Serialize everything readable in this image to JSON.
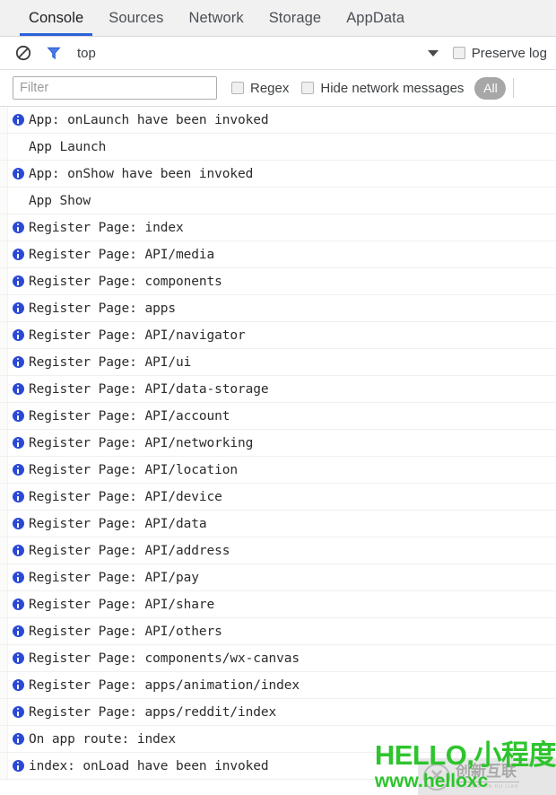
{
  "tabs": [
    {
      "label": "Console",
      "active": true
    },
    {
      "label": "Sources",
      "active": false
    },
    {
      "label": "Network",
      "active": false
    },
    {
      "label": "Storage",
      "active": false
    },
    {
      "label": "AppData",
      "active": false
    }
  ],
  "toolbar": {
    "clear_icon": "clear-console-icon",
    "filter_icon": "funnel-filter-icon",
    "context_selector": "top",
    "dropdown_icon": "chevron-down-icon",
    "preserve_log_label": "Preserve log",
    "preserve_log_checked": false
  },
  "filterbar": {
    "filter_placeholder": "Filter",
    "filter_value": "",
    "regex_label": "Regex",
    "regex_checked": false,
    "hide_network_label": "Hide network messages",
    "hide_network_checked": false,
    "level_pill": "All"
  },
  "colors": {
    "accent": "#2962d9",
    "info_icon": "#2a49d6",
    "tabbar_bg": "#f1f1f1",
    "watermark_green": "#2ec42e",
    "pill_gray": "#a7a7a7"
  },
  "logs": [
    {
      "level": "info",
      "text": "App: onLaunch have been invoked"
    },
    {
      "level": "plain",
      "text": "App Launch"
    },
    {
      "level": "info",
      "text": "App: onShow have been invoked"
    },
    {
      "level": "plain",
      "text": "App Show"
    },
    {
      "level": "info",
      "text": "Register Page: index"
    },
    {
      "level": "info",
      "text": "Register Page: API/media"
    },
    {
      "level": "info",
      "text": "Register Page: components"
    },
    {
      "level": "info",
      "text": "Register Page: apps"
    },
    {
      "level": "info",
      "text": "Register Page: API/navigator"
    },
    {
      "level": "info",
      "text": "Register Page: API/ui"
    },
    {
      "level": "info",
      "text": "Register Page: API/data-storage"
    },
    {
      "level": "info",
      "text": "Register Page: API/account"
    },
    {
      "level": "info",
      "text": "Register Page: API/networking"
    },
    {
      "level": "info",
      "text": "Register Page: API/location"
    },
    {
      "level": "info",
      "text": "Register Page: API/device"
    },
    {
      "level": "info",
      "text": "Register Page: API/data"
    },
    {
      "level": "info",
      "text": "Register Page: API/address"
    },
    {
      "level": "info",
      "text": "Register Page: API/pay"
    },
    {
      "level": "info",
      "text": "Register Page: API/share"
    },
    {
      "level": "info",
      "text": "Register Page: API/others"
    },
    {
      "level": "info",
      "text": "Register Page: components/wx-canvas"
    },
    {
      "level": "info",
      "text": "Register Page: apps/animation/index"
    },
    {
      "level": "info",
      "text": "Register Page: apps/reddit/index"
    },
    {
      "level": "info",
      "text": "On app route: index"
    },
    {
      "level": "info",
      "text": "index: onLoad have been invoked"
    }
  ],
  "watermark": {
    "line1": "HELLO,小程度",
    "line2": "www.helloxc",
    "logo_mark": "✕",
    "logo_cn": "创新互联",
    "logo_en": "CHUANG XIN HU LIAN"
  }
}
